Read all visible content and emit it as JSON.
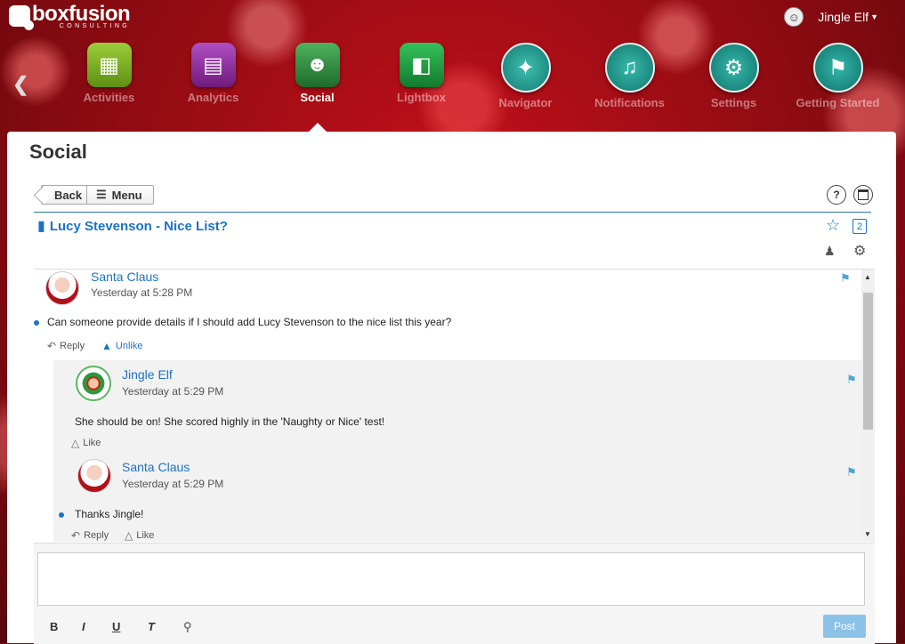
{
  "brand": {
    "name": "boxfusion",
    "sub": "CONSULTING"
  },
  "user": {
    "name": "Jingle Elf",
    "accessibility_icon": "accessibility-icon"
  },
  "nav": {
    "apps": [
      {
        "label": "Activities",
        "icon": "activities-icon",
        "color": "#7cae24",
        "active": false
      },
      {
        "label": "Analytics",
        "icon": "analytics-icon",
        "color": "#8e2c9d",
        "active": false
      },
      {
        "label": "Social",
        "icon": "social-icon",
        "color": "#2f8b41",
        "active": true
      },
      {
        "label": "Lightbox",
        "icon": "lightbox-icon",
        "color": "#1d9a3c",
        "active": false
      },
      {
        "label": "Navigator",
        "icon": "compass-icon",
        "color": "#1b9a8e",
        "active": false
      },
      {
        "label": "Notifications",
        "icon": "bell-icon",
        "color": "#179186",
        "active": false
      },
      {
        "label": "Settings",
        "icon": "gears-icon",
        "color": "#17908a",
        "active": false
      },
      {
        "label": "Getting Started",
        "icon": "flag-icon",
        "color": "#168e85",
        "active": false
      }
    ]
  },
  "page": {
    "title": "Social"
  },
  "toolbar": {
    "back_label": "Back",
    "menu_label": "Menu",
    "help_label": "?"
  },
  "thread": {
    "title": "Lucy Stevenson - Nice List?",
    "follower_count": "2"
  },
  "posts": {
    "main": {
      "author": "Santa Claus",
      "time": "Yesterday at 5:28 PM",
      "text": "Can someone provide details if I should add Lucy Stevenson to the nice list this year?",
      "reply_label": "Reply",
      "like_label": "Unlike"
    },
    "reply1": {
      "author": "Jingle Elf",
      "time": "Yesterday at 5:29 PM",
      "text": "She should be on! She scored highly in the 'Naughty or Nice' test!",
      "like_label": "Like"
    },
    "reply2": {
      "author": "Santa Claus",
      "time": "Yesterday at 5:29 PM",
      "text": "Thanks Jingle!",
      "reply_label": "Reply",
      "like_label": "Like"
    }
  },
  "composer": {
    "value": "",
    "bold": "B",
    "italic": "I",
    "underline": "U",
    "clear_format": "T",
    "post_label": "Post"
  }
}
